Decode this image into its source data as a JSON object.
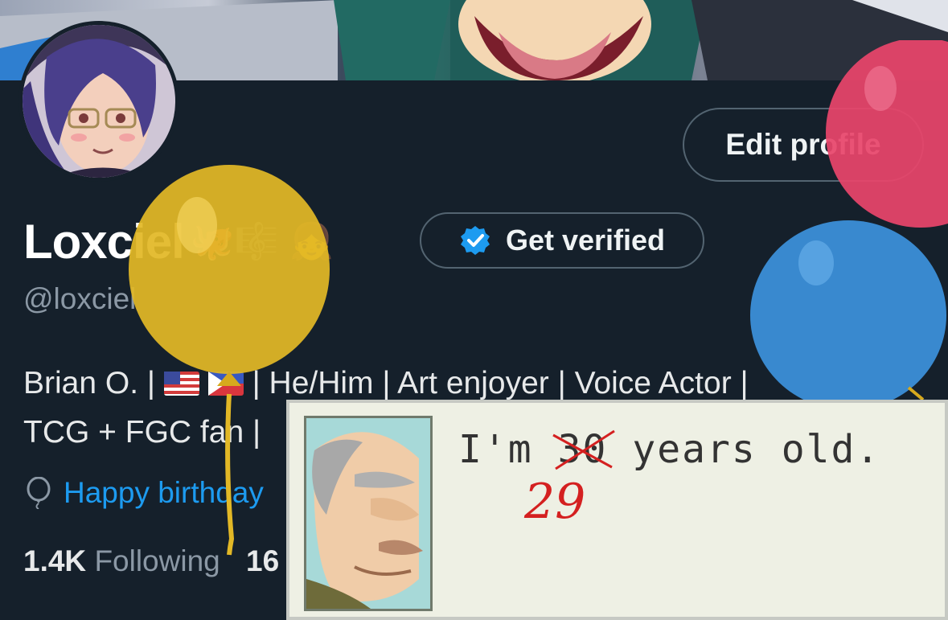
{
  "profile": {
    "display_name": "Loxciel",
    "name_emojis": "🐙🎼 👧",
    "handle": "@loxciel",
    "bio_line1_a": "Brian O. |",
    "bio_line1_b": "| He/Him | Art enjoyer | Voice Actor |",
    "bio_line2": "TCG + FGC fan |",
    "location": "Happy birthday",
    "following_count": "1.4K",
    "following_label": "Following",
    "followers_count": "16"
  },
  "buttons": {
    "edit_profile": "Edit profile",
    "get_verified": "Get verified"
  },
  "meme": {
    "text_prefix": "I'm",
    "old_age": "30",
    "text_suffix": "years old.",
    "new_age": "29"
  },
  "colors": {
    "background": "#15202b",
    "link": "#1d9bf0",
    "verified_badge": "#1d9bf0",
    "balloon_yellow": "#e2b826",
    "balloon_red": "#e8456a",
    "balloon_blue": "#3b8fd8"
  },
  "icons": {
    "verified": "verified-badge-icon",
    "location": "balloon-pin-icon"
  }
}
